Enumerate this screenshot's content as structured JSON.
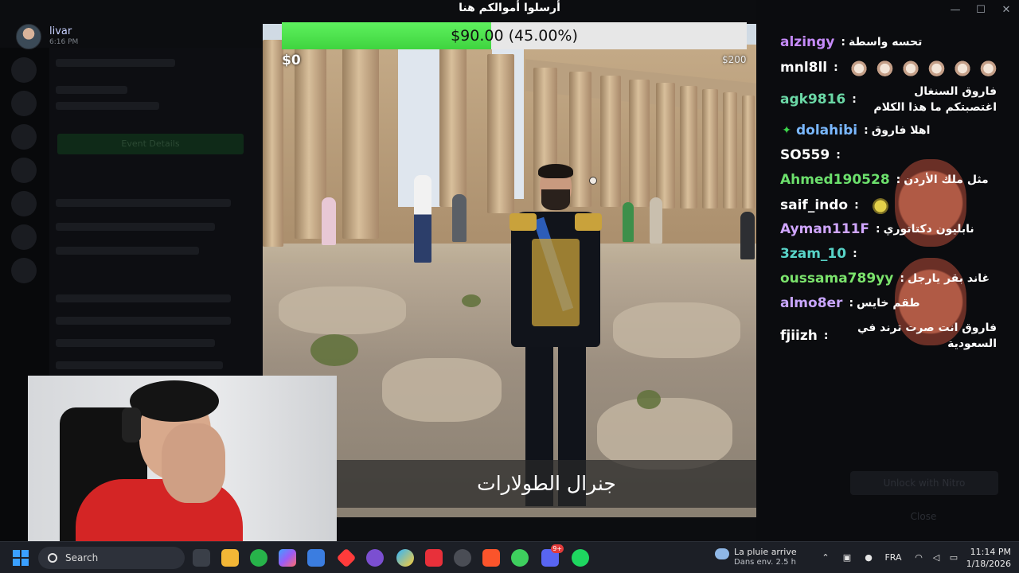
{
  "profile": {
    "username": "livar",
    "time": "6:16 PM"
  },
  "background_app": {
    "nitro_label": "Unlock with Nitro",
    "close_label": "Close",
    "event_details_label": "Event Details"
  },
  "donation": {
    "title": "أرسلوا أموالكم هنا",
    "amount_label": "$90.00 (45.00%)",
    "progress_percent": 45,
    "min_label": "$0",
    "max_label": "$200"
  },
  "stream": {
    "caption": "جنرال الطولارات"
  },
  "chat": {
    "messages": [
      {
        "user": "alzingy",
        "color": "#c58af9",
        "text": "تحسه واسطة",
        "emotes": []
      },
      {
        "user": "mnl8ll",
        "color": "#ffffff",
        "text": "",
        "emotes": [
          "cat",
          "cat",
          "cat",
          "cat",
          "cat",
          "cat"
        ]
      },
      {
        "user": "agk9816",
        "color": "#6bd8a6",
        "text": "فاروق السنغال اغتصبتكم ما هذا الكلام",
        "emotes": []
      },
      {
        "user": "dolahibi",
        "color": "#7ab8ff",
        "text": "اهلا فاروق",
        "emotes": [],
        "badge": "✦"
      },
      {
        "user": "SO559",
        "color": "#ffffff",
        "text": "",
        "emotes": [
          "face"
        ]
      },
      {
        "user": "Ahmed190528",
        "color": "#6ce06c",
        "text": "مثل ملك الأردن",
        "emotes": [
          "man"
        ]
      },
      {
        "user": "saif_indo",
        "color": "#ffffff",
        "text": "",
        "emotes": [
          "yellow"
        ]
      },
      {
        "user": "Ayman111F",
        "color": "#d0a6ff",
        "text": "نابليون دكتاتوري",
        "emotes": []
      },
      {
        "user": "3zam_10",
        "color": "#58d3c7",
        "text": "",
        "emotes": [
          "face"
        ]
      },
      {
        "user": "oussama789yy",
        "color": "#7be36c",
        "text": "غاند بقر يارجل",
        "emotes": []
      },
      {
        "user": "almo8er",
        "color": "#c9a6ff",
        "text": "طقم خايس",
        "emotes": []
      },
      {
        "user": "fjiizh",
        "color": "#ffffff",
        "text": "فاروق انت صرت ترند في السعودية",
        "emotes": []
      }
    ]
  },
  "taskbar": {
    "search_label": "Search",
    "weather_title": "La pluie arrive",
    "weather_sub": "Dans env. 2.5 h",
    "language": "FRA",
    "time": "11:14 PM",
    "date": "1/18/2026",
    "discord_badge": "9+"
  },
  "colors": {
    "progress_fill": "#47df47",
    "taskbar": "#1c1f26"
  }
}
